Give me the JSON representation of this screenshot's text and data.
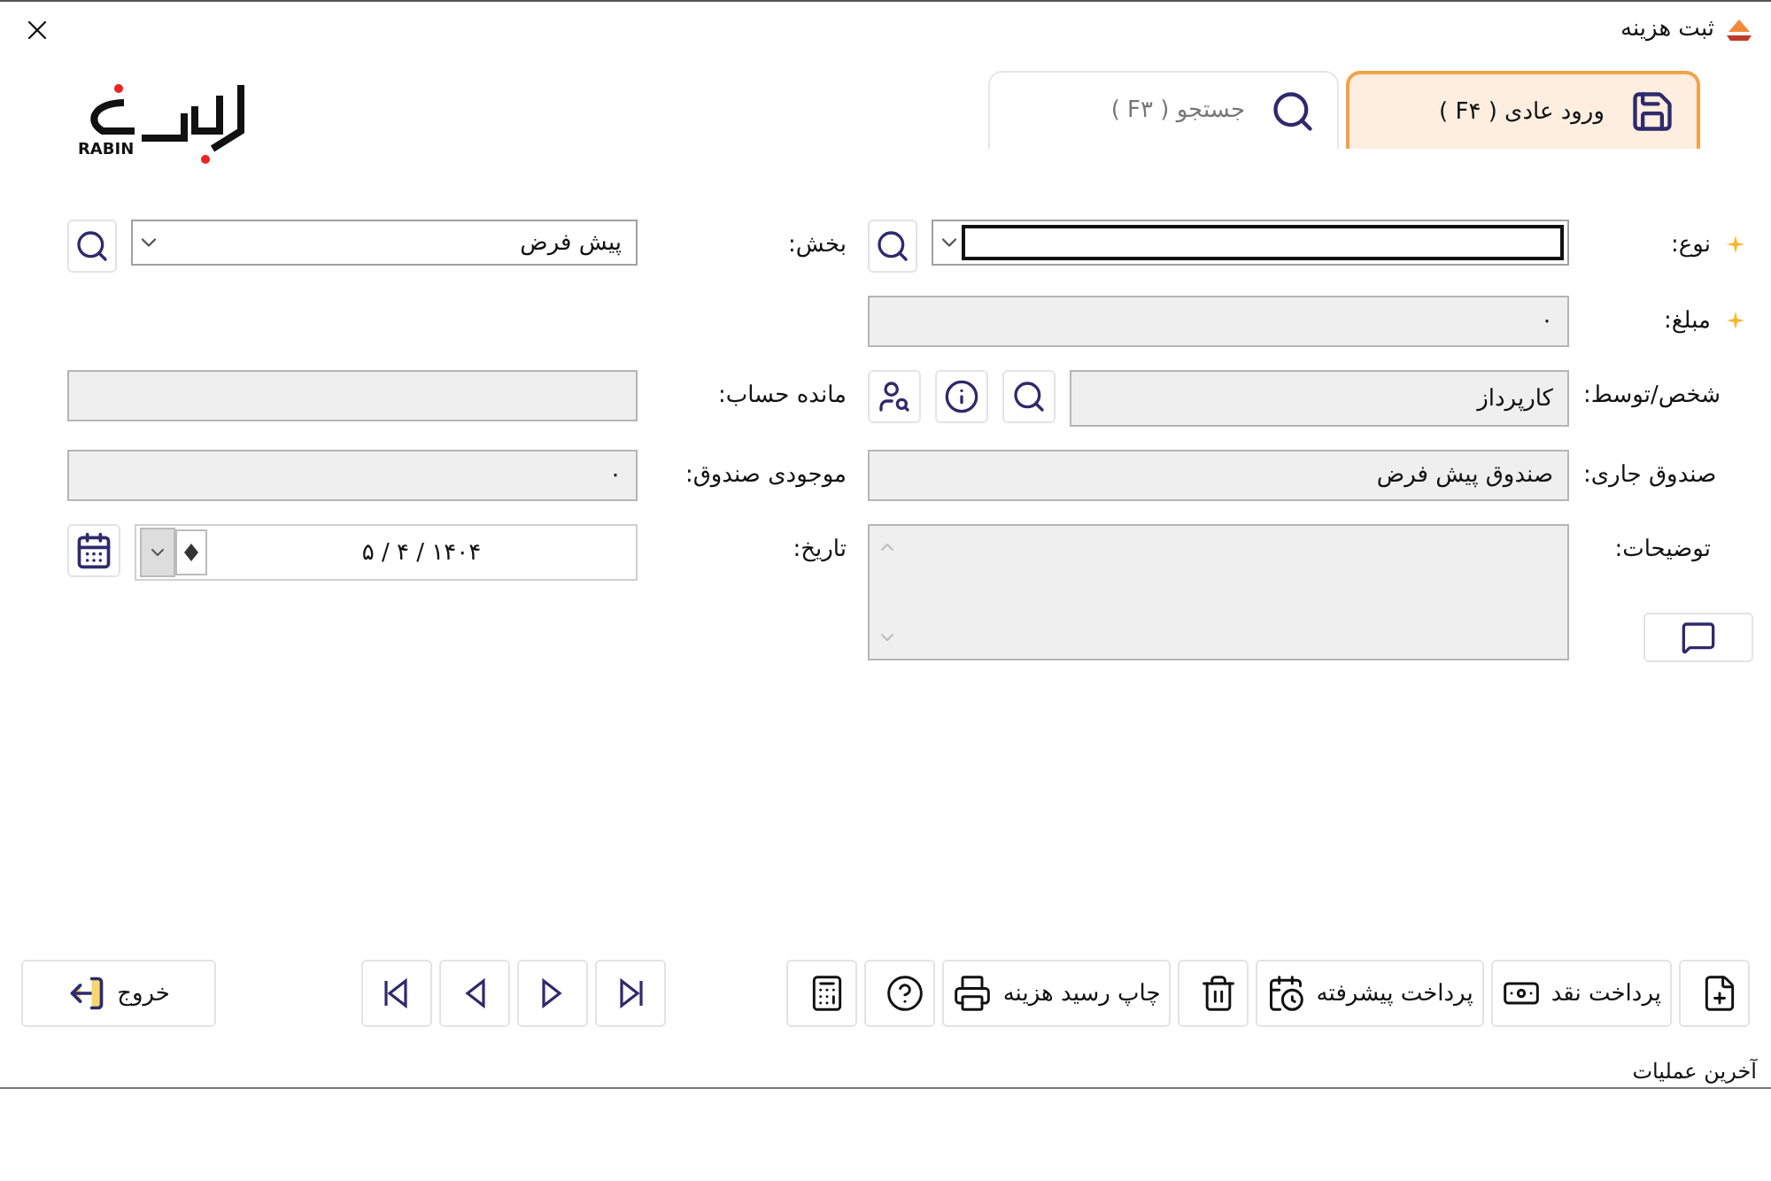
{
  "window": {
    "title": "ثبت هزینه"
  },
  "tabs": [
    {
      "label": "ورود عادی ( F۴ )",
      "selected": true
    },
    {
      "label": "جستجو ( F۳ )",
      "selected": false
    }
  ],
  "logo": {
    "text": "RABIN"
  },
  "form_rows": [
    {
      "fields": [
        {
          "kind": "combo",
          "label": "نوع:",
          "required": true,
          "focused": true
        },
        {
          "kind": "combo",
          "label": "بخش:",
          "focused": false,
          "value": "پیش فرض"
        }
      ]
    },
    {
      "fields": [
        {
          "kind": "text",
          "label": "مبلغ:",
          "required": true,
          "value": "۰"
        }
      ]
    },
    {
      "fields": [
        {
          "kind": "lookup",
          "label": "شخص/توسط:",
          "required": false,
          "value": "کارپرداز"
        },
        {
          "kind": "text",
          "label": "مانده حساب:"
        }
      ]
    },
    {
      "fields": [
        {
          "kind": "text",
          "label": "صندوق جاری:",
          "required": false,
          "value": "صندوق پیش فرض"
        },
        {
          "kind": "text",
          "label": "موجودی صندوق:",
          "value": "۰"
        }
      ]
    },
    {
      "fields": [
        {
          "kind": "textarea",
          "label": "توضیحات:",
          "required": false
        },
        {
          "kind": "date",
          "label": "تاریخ:",
          "value": "۱۴۰۴ / ۴ / ۵"
        }
      ]
    }
  ],
  "toolbar": [
    {
      "kind": "new"
    },
    {
      "kind": "cash",
      "label": "پرداخت نقد"
    },
    {
      "kind": "advanced",
      "label": "پرداخت پیشرفته"
    },
    {
      "kind": "delete"
    },
    {
      "kind": "print",
      "label": "چاپ رسید هزینه"
    },
    {
      "kind": "help"
    },
    {
      "kind": "calculator"
    }
  ],
  "exit_button": {
    "label": "خروج"
  },
  "status_bar": {
    "text": "آخرین عملیات"
  }
}
